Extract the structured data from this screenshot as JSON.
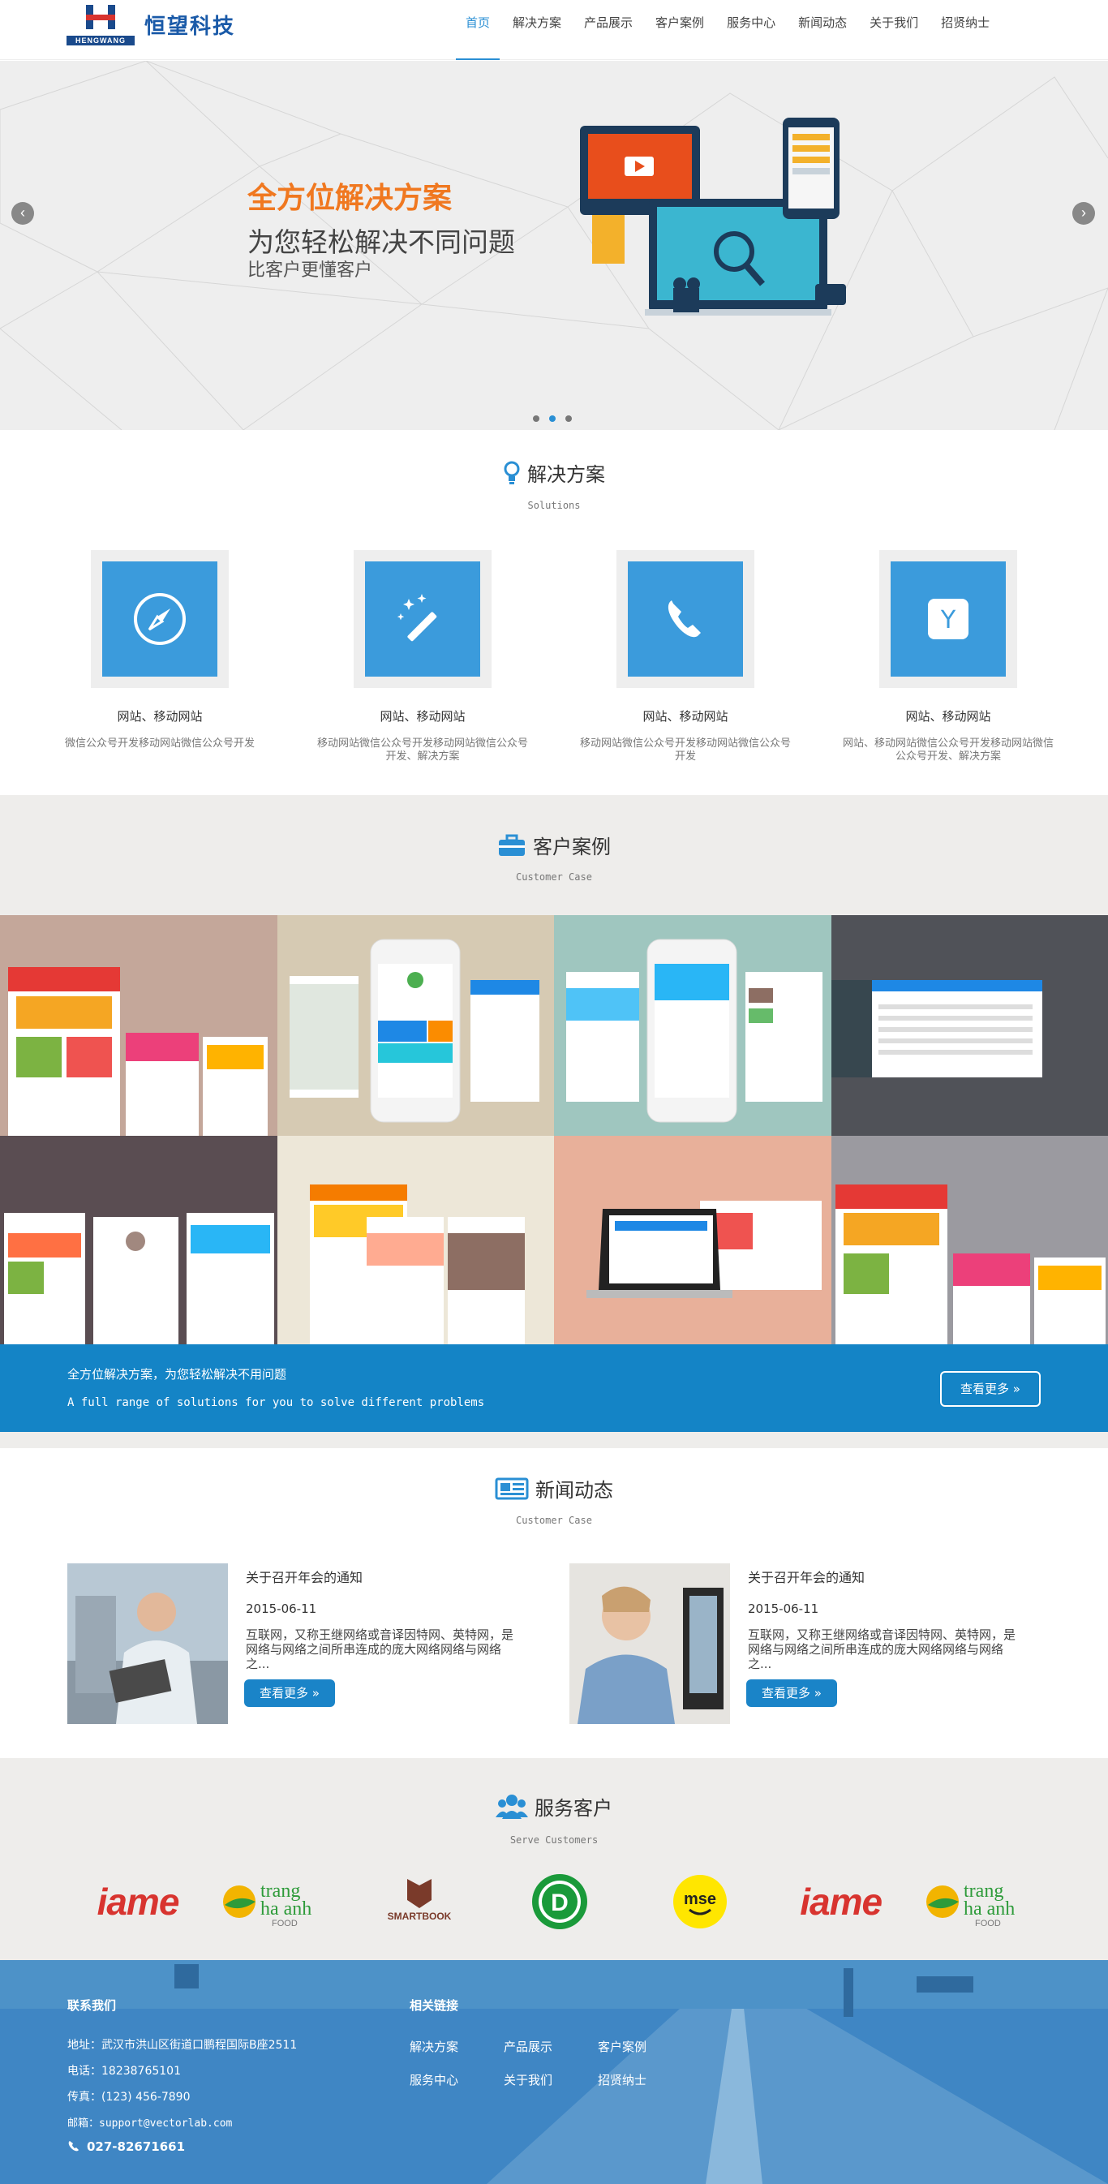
{
  "header": {
    "logo_en": "HENGWANG",
    "logo_cn": "恒望科技",
    "nav": [
      "首页",
      "解决方案",
      "产品展示",
      "客户案例",
      "服务中心",
      "新闻动态",
      "关于我们",
      "招贤纳士"
    ],
    "active_index": 0
  },
  "banner": {
    "line1": "全方位解决方案",
    "line2": "为您轻松解决不同问题",
    "line3": "比客户更懂客户",
    "arrow_left": "‹",
    "arrow_right": "›",
    "slide_count": 3,
    "active_slide": 2
  },
  "solutions": {
    "title": "解决方案",
    "subtitle": "Solutions",
    "items": [
      {
        "icon": "compass-icon",
        "name": "网站、移动网站",
        "desc": "微信公众号开发移动网站微信公众号开发"
      },
      {
        "icon": "magic-wand-icon",
        "name": "网站、移动网站",
        "desc": "移动网站微信公众号开发移动网站微信公众号开发、解决方案"
      },
      {
        "icon": "phone-icon",
        "name": "网站、移动网站",
        "desc": "移动网站微信公众号开发移动网站微信公众号开发"
      },
      {
        "icon": "y-app-icon",
        "name": "网站、移动网站",
        "desc": "网站、移动网站微信公众号开发移动网站微信公众号开发、解决方案"
      }
    ]
  },
  "cases": {
    "title": "客户案例",
    "subtitle": "Customer Case",
    "tiles": [
      "#c4a79a",
      "#d6cab3",
      "#9fc6bf",
      "#505258",
      "#5a4d52",
      "#ede7d8",
      "#e8b09a",
      "#9b9aa0"
    ],
    "strip_line1": "全方位解决方案，为您轻松解决不用问题",
    "strip_line2": "A full range of solutions for you to solve different problems",
    "strip_button": "查看更多 »"
  },
  "news": {
    "title": "新闻动态",
    "subtitle": "Customer Case",
    "items": [
      {
        "title": "关于召开年会的通知",
        "date": "2015-06-11",
        "body": "互联网，又称王继网络或音译因特网、英特网，是网络与网络之间所串连成的庞大网络网络与网络之...",
        "button": "查看更多 »"
      },
      {
        "title": "关于召开年会的通知",
        "date": "2015-06-11",
        "body": "互联网，又称王继网络或音译因特网、英特网，是网络与网络之间所串连成的庞大网络网络与网络之...",
        "button": "查看更多 »"
      }
    ]
  },
  "customers": {
    "title": "服务客户",
    "subtitle": "Serve Customers",
    "logos": [
      "iame",
      "trang ha anh FOOD",
      "SMARTBOOK",
      "D",
      "mse",
      "iame",
      "trang ha anh FOOD"
    ]
  },
  "footer": {
    "contact_title": "联系我们",
    "address": "地址：武汉市洪山区街道口鹏程国际B座2511",
    "tel": "电话：18238765101",
    "fax": "传真：(123) 456-7890",
    "email": "邮箱：support@vectorlab.com",
    "phone": "027-82671661",
    "links_title": "相关链接",
    "links": [
      "解决方案",
      "产品展示",
      "客户案例",
      "服务中心",
      "关于我们",
      "招贤纳士"
    ]
  },
  "colors": {
    "accent": "#2a8fd4",
    "orange": "#f07820",
    "strip": "#1484c6",
    "footer": "#2f7fbf"
  }
}
